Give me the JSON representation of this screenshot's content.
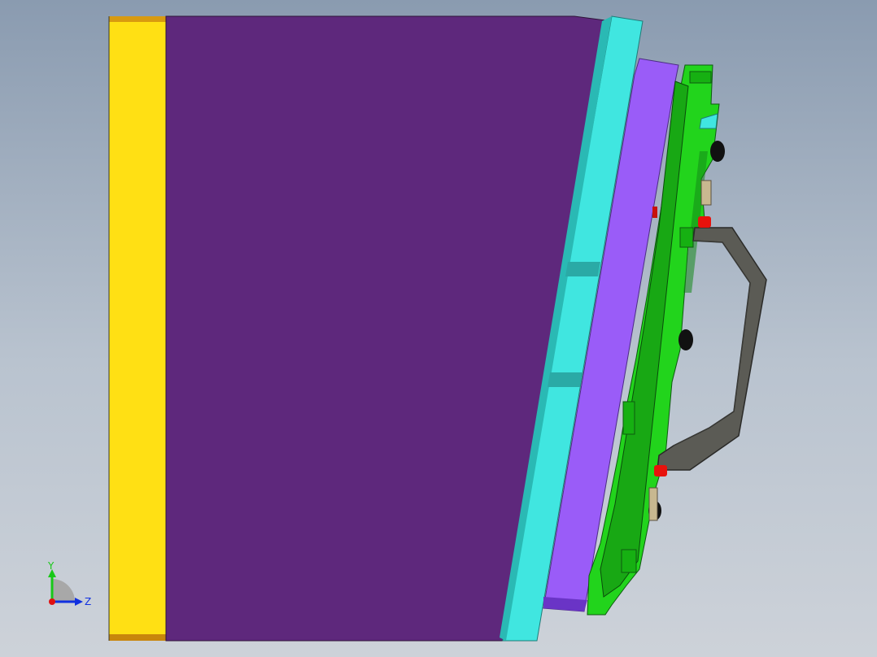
{
  "viewport": {
    "background_top": "#8a9bb0",
    "background_bottom": "#cdd2d9"
  },
  "model": {
    "parts": [
      {
        "name": "base-plate",
        "color": "#ffe014",
        "edge_color": "#c8860c"
      },
      {
        "name": "main-body",
        "color": "#5e287c"
      },
      {
        "name": "cyan-plate",
        "color": "#40e6e0"
      },
      {
        "name": "violet-plate",
        "color": "#9a5cf8"
      },
      {
        "name": "green-plate",
        "color": "#22d41c"
      },
      {
        "name": "handle",
        "color": "#5b5b55"
      },
      {
        "name": "black-knob",
        "color": "#111111"
      },
      {
        "name": "red-pin",
        "color": "#e8120c"
      }
    ]
  },
  "triad": {
    "y_label": "Y",
    "z_label": "Z",
    "y_color": "#18c818",
    "z_color": "#1030e0",
    "origin_color": "#e01010"
  }
}
